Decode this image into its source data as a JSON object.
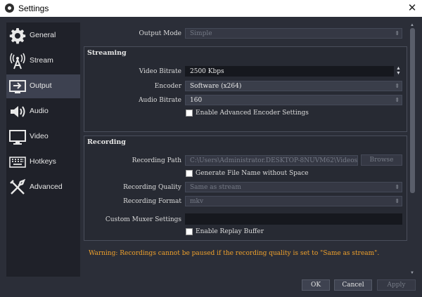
{
  "window": {
    "title": "Settings",
    "close_glyph": "✕"
  },
  "sidebar": {
    "items": [
      {
        "label": "General",
        "icon": "gear-icon"
      },
      {
        "label": "Stream",
        "icon": "antenna-icon"
      },
      {
        "label": "Output",
        "icon": "output-icon",
        "active": true
      },
      {
        "label": "Audio",
        "icon": "speaker-icon"
      },
      {
        "label": "Video",
        "icon": "monitor-icon"
      },
      {
        "label": "Hotkeys",
        "icon": "keyboard-icon"
      },
      {
        "label": "Advanced",
        "icon": "tools-icon"
      }
    ]
  },
  "output_mode": {
    "label": "Output Mode",
    "value": "Simple"
  },
  "streaming": {
    "title": "Streaming",
    "video_bitrate": {
      "label": "Video Bitrate",
      "value": "2500 Kbps"
    },
    "encoder": {
      "label": "Encoder",
      "value": "Software (x264)"
    },
    "audio_bitrate": {
      "label": "Audio Bitrate",
      "value": "160"
    },
    "advanced_encoder": {
      "label": "Enable Advanced Encoder Settings",
      "checked": false
    }
  },
  "recording": {
    "title": "Recording",
    "path": {
      "label": "Recording Path",
      "value": "C:\\Users\\Administrator.DESKTOP-8NUVM62\\Videos"
    },
    "browse_label": "Browse",
    "no_space": {
      "label": "Generate File Name without Space",
      "checked": false
    },
    "quality": {
      "label": "Recording Quality",
      "value": "Same as stream"
    },
    "format": {
      "label": "Recording Format",
      "value": "mkv"
    },
    "muxer": {
      "label": "Custom Muxer Settings",
      "value": ""
    },
    "replay_buffer": {
      "label": "Enable Replay Buffer",
      "checked": false
    }
  },
  "warning": "Warning: Recordings cannot be paused if the recording quality is set to \"Same as stream\".",
  "footer": {
    "ok_label": "OK",
    "cancel_label": "Cancel",
    "apply_label": "Apply"
  },
  "colors": {
    "background": "#2b2e38",
    "sidebar": "#1f2129",
    "active_item": "#3d4150",
    "warning": "#f0a12b"
  }
}
